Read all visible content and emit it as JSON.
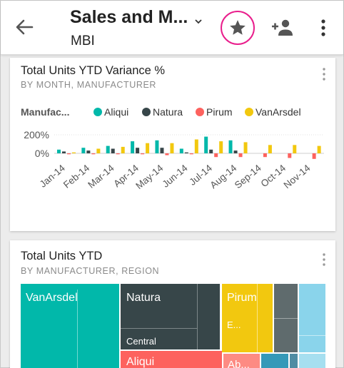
{
  "header": {
    "back_icon": "arrow-left-icon",
    "title": "Sales and M...",
    "subtitle": "MBI",
    "caret_icon": "chevron-down-icon",
    "favorite_icon": "star-icon",
    "share_icon": "person-add-icon",
    "more_icon": "more-vertical-icon",
    "favorite_ring_color": "#e91e8c"
  },
  "tiles": [
    {
      "title": "Total Units YTD Variance %",
      "subtitle": "BY MONTH, MANUFACTURER",
      "more_icon": "more-vertical-icon"
    },
    {
      "title": "Total Units YTD",
      "subtitle": "BY MANUFACTURER, REGION",
      "more_icon": "more-vertical-icon"
    }
  ],
  "legend": {
    "title": "Manufac...",
    "items": [
      {
        "label": "Aliqui",
        "color": "#01b8aa"
      },
      {
        "label": "Natura",
        "color": "#374649"
      },
      {
        "label": "Pirum",
        "color": "#fd625e"
      },
      {
        "label": "VanArsdel",
        "color": "#f2c80f"
      }
    ]
  },
  "chart_data": {
    "type": "bar",
    "categories": [
      "Jan-14",
      "Feb-14",
      "Mar-14",
      "Apr-14",
      "May-14",
      "Jun-14",
      "Jul-14",
      "Aug-14",
      "Sep-14",
      "Oct-14",
      "Nov-14"
    ],
    "x_tick_labels": [
      "Jan-14",
      "Feb-14",
      "Mar-14",
      "Apr-14",
      "May-14",
      "Jun-14",
      "Jul-14",
      "Aug-14",
      "Sep-14",
      "Oct-14",
      "Nov-14"
    ],
    "y_tick_labels": [
      "200%",
      "0%"
    ],
    "ylim": [
      -60,
      230
    ],
    "grid": true,
    "legend_placement": "top",
    "series": [
      {
        "name": "Aliqui",
        "color": "#01b8aa",
        "values": [
          40,
          60,
          80,
          130,
          140,
          50,
          180,
          140,
          0,
          0,
          0
        ]
      },
      {
        "name": "Natura",
        "color": "#374649",
        "values": [
          20,
          30,
          50,
          60,
          60,
          10,
          40,
          30,
          0,
          0,
          0
        ]
      },
      {
        "name": "Pirum",
        "color": "#fd625e",
        "values": [
          -10,
          -10,
          -10,
          -10,
          -20,
          -10,
          -40,
          -40,
          -40,
          -50,
          -60
        ]
      },
      {
        "name": "VanArsdel",
        "color": "#f2c80f",
        "values": [
          10,
          50,
          70,
          110,
          110,
          150,
          130,
          120,
          90,
          90,
          80
        ]
      }
    ]
  },
  "treemap": {
    "cells": [
      {
        "label": "VanArsdel",
        "color": "#01b8aa"
      },
      {
        "label": "Natura",
        "color": "#374649"
      },
      {
        "label": "Central",
        "color": "#374649"
      },
      {
        "label": "Pirum",
        "color": "#f2c80f"
      },
      {
        "label": "E...",
        "color": "#f2c80f"
      },
      {
        "label": "Aliqui",
        "color": "#fd625e"
      },
      {
        "label": "Ab...",
        "color": "#fd625e"
      },
      {
        "label": "",
        "color": "#5f6b6d"
      },
      {
        "label": "",
        "color": "#8ad4eb"
      }
    ]
  }
}
